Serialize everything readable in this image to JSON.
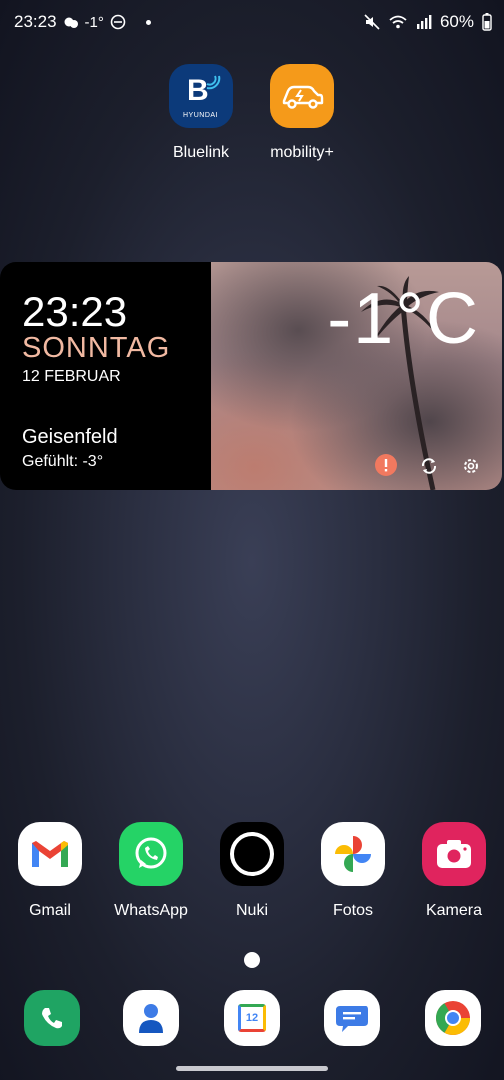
{
  "status": {
    "time": "23:23",
    "temp": "-1°",
    "battery": "60%"
  },
  "top_apps": [
    {
      "label": "Bluelink",
      "icon": "bluelink-hyundai-icon",
      "logo_letter": "B",
      "logo_sub": "HYUNDAI"
    },
    {
      "label": "mobility+",
      "icon": "ev-car-charging-icon"
    }
  ],
  "widget": {
    "time": "23:23",
    "day": "SONNTAG",
    "date": "12 FEBRUAR",
    "city": "Geisenfeld",
    "feels": "Gefühlt: -3°",
    "temperature": "-1°C",
    "accent": "#f1b9a2",
    "icons": [
      "alert-icon",
      "refresh-icon",
      "settings-icon"
    ]
  },
  "row_apps": [
    {
      "label": "Gmail",
      "icon": "gmail-icon"
    },
    {
      "label": "WhatsApp",
      "icon": "whatsapp-icon"
    },
    {
      "label": "Nuki",
      "icon": "nuki-icon"
    },
    {
      "label": "Fotos",
      "icon": "google-photos-icon"
    },
    {
      "label": "Kamera",
      "icon": "camera-icon"
    }
  ],
  "dock": [
    {
      "icon": "phone-icon"
    },
    {
      "icon": "contacts-icon"
    },
    {
      "icon": "calendar-icon",
      "day": "12"
    },
    {
      "icon": "messages-icon"
    },
    {
      "icon": "chrome-icon"
    }
  ]
}
